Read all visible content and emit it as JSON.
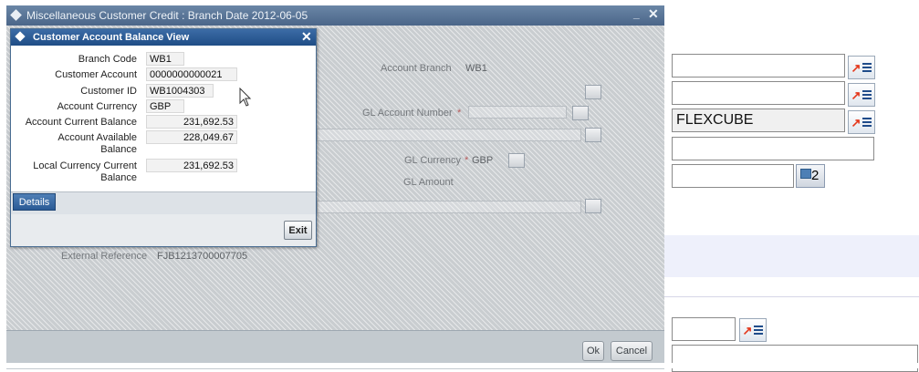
{
  "background_form": {
    "field_value": "FLEXCUBE",
    "calendar_button_text": "2"
  },
  "main_window": {
    "title": "Miscellaneous Customer Credit : Branch Date 2012-06-05",
    "minimize_label": "_",
    "close_label": "✕",
    "labels": {
      "account_branch": "Account Branch",
      "account_branch_value": "WB1",
      "gl_account_number": "GL Account Number",
      "gl_currency": "GL Currency",
      "gl_currency_value": "GBP",
      "gl_amount": "GL Amount",
      "external_reference": "External Reference",
      "external_reference_value": "FJB1213700007705",
      "required_marker": "*"
    },
    "footer": {
      "ok_label": "Ok",
      "cancel_label": "Cancel"
    }
  },
  "dialog": {
    "title": "Customer Account Balance View",
    "close_label": "✕",
    "fields": {
      "branch_code_label": "Branch Code",
      "branch_code_value": "WB1",
      "customer_account_label": "Customer Account",
      "customer_account_value": "0000000000021",
      "customer_id_label": "Customer ID",
      "customer_id_value": "WB1004303",
      "account_currency_label": "Account Currency",
      "account_currency_value": "GBP",
      "account_current_balance_label": "Account Current Balance",
      "account_current_balance_value": "231,692.53",
      "account_available_balance_label_1": "Account Available",
      "account_available_balance_label_2": "Balance",
      "account_available_balance_value": "228,049.67",
      "local_currency_balance_label_1": "Local Currency Current",
      "local_currency_balance_label_2": "Balance",
      "local_currency_balance_value": "231,692.53"
    },
    "tab_details_label": "Details",
    "exit_label": "Exit"
  },
  "colors": {
    "dialog_title_bar": "#2a5a95",
    "main_title_bar": "#5a7699",
    "lov_arrow": "#e4381c"
  }
}
